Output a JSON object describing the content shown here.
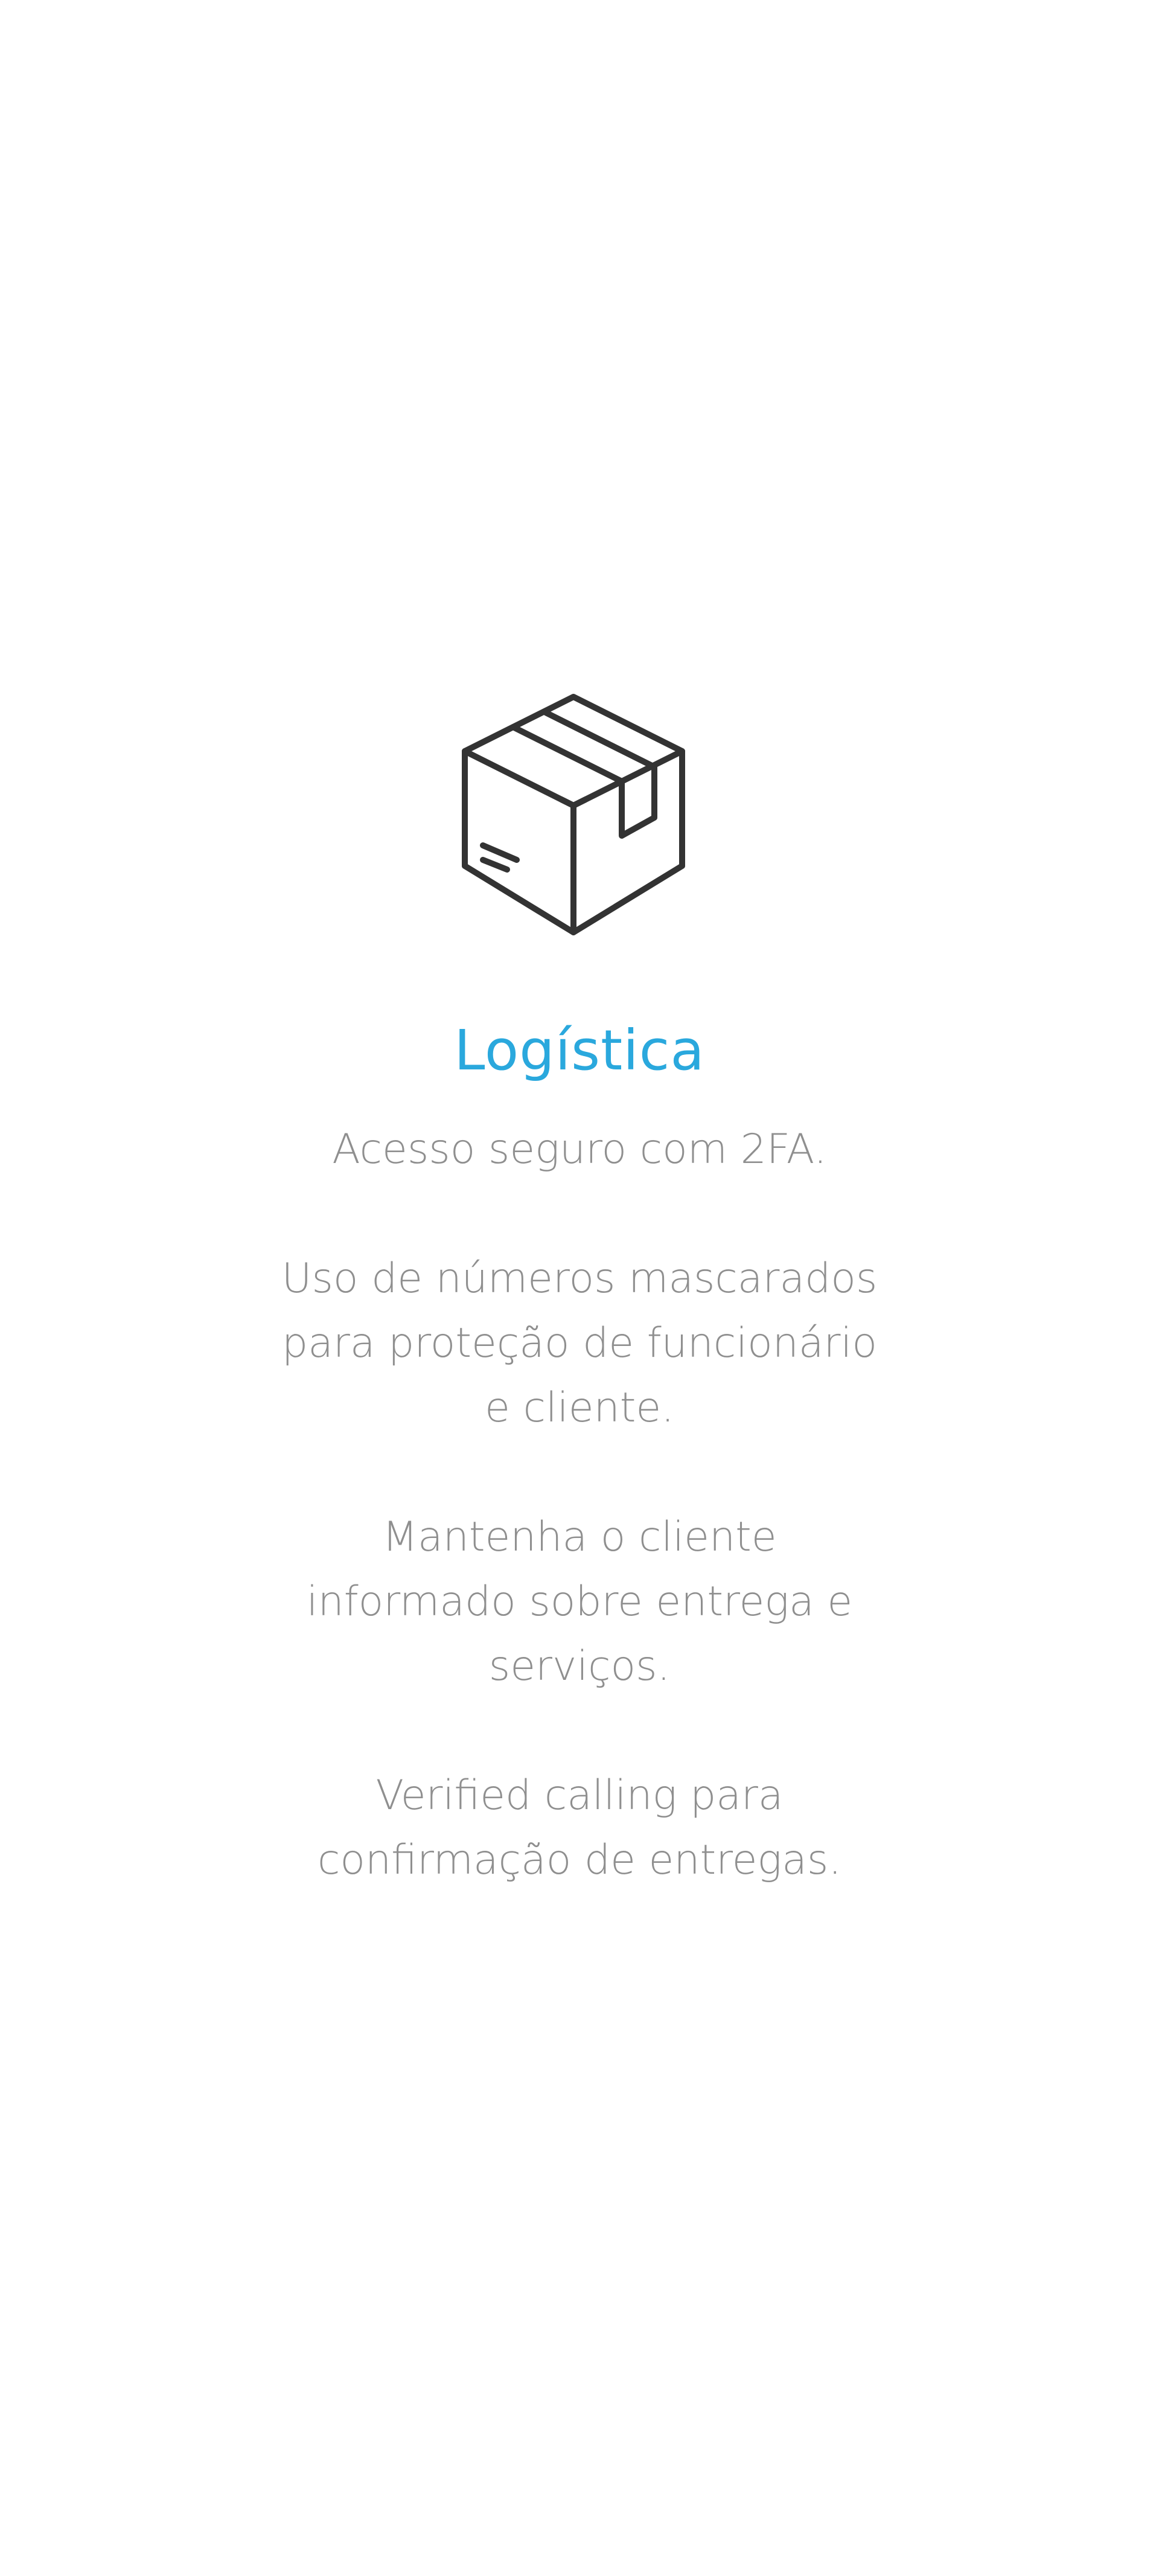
{
  "section": {
    "icon": "package-box-icon",
    "title": "Logística",
    "features": [
      "Acesso seguro com 2FA.",
      "Uso de números mascarados para proteção de funcionário e cliente.",
      "Mantenha o cliente informado sobre entrega e serviços.",
      "Verified calling para confirmação de entregas."
    ]
  },
  "colors": {
    "title": "#2aa8dd",
    "body_text": "#8f8f8f",
    "icon_stroke": "#333333",
    "background": "#ffffff"
  }
}
